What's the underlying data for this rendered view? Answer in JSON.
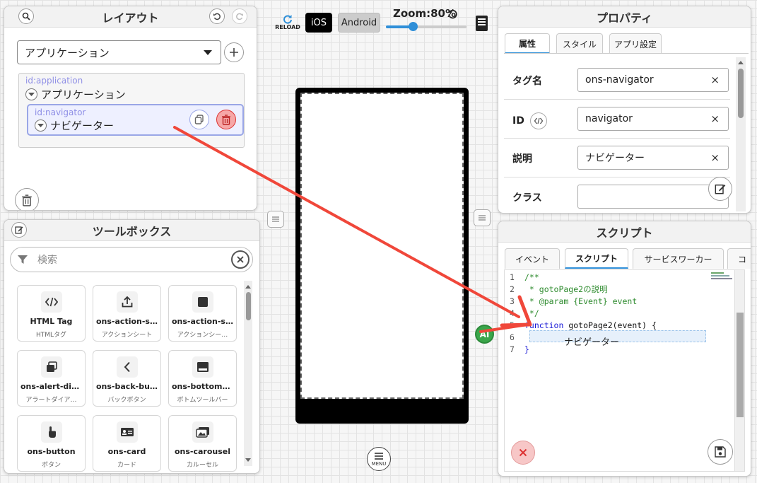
{
  "layout_panel": {
    "title": "レイアウト",
    "select_value": "アプリケーション",
    "tree": {
      "root": {
        "id_label": "id:application",
        "label": "アプリケーション"
      },
      "child": {
        "id_label": "id:navigator",
        "label": "ナビゲーター"
      }
    }
  },
  "toolbox_panel": {
    "title": "ツールボックス",
    "search_placeholder": "検索",
    "items": [
      {
        "title": "HTML Tag",
        "subtitle": "HTMLタグ",
        "icon": "code-icon"
      },
      {
        "title": "ons-action-sh…",
        "subtitle": "アクションシート",
        "icon": "share-icon"
      },
      {
        "title": "ons-action-sh…",
        "subtitle": "アクションシー…",
        "icon": "square-icon"
      },
      {
        "title": "ons-alert-dialog",
        "subtitle": "アラートダイア…",
        "icon": "dialog-icon"
      },
      {
        "title": "ons-back-butt…",
        "subtitle": "バックボタン",
        "icon": "chevron-left-icon"
      },
      {
        "title": "ons-bottom-t…",
        "subtitle": "ボトムツールバー",
        "icon": "toolbar-icon"
      },
      {
        "title": "ons-button",
        "subtitle": "ボタン",
        "icon": "hand-pointer-icon"
      },
      {
        "title": "ons-card",
        "subtitle": "カード",
        "icon": "id-card-icon"
      },
      {
        "title": "ons-carousel",
        "subtitle": "カルーセル",
        "icon": "images-icon"
      }
    ]
  },
  "toolbar": {
    "reload_label": "RELOAD",
    "ios_label": "iOS",
    "android_label": "Android",
    "zoom_label": "Zoom:80%",
    "zoom_value": 0.8
  },
  "property_panel": {
    "title": "プロパティ",
    "tabs": [
      "属性",
      "スタイル",
      "アプリ設定"
    ],
    "rows": [
      {
        "label": "タグ名",
        "value": "ons-navigator"
      },
      {
        "label": "ID",
        "value": "navigator"
      },
      {
        "label": "説明",
        "value": "ナビゲーター"
      },
      {
        "label": "クラス",
        "value": ""
      }
    ]
  },
  "script_panel": {
    "title": "スクリプト",
    "tabs": [
      "イベント",
      "スクリプト",
      "サービスワーカー",
      "コ"
    ],
    "ai_label": "AI",
    "drag_label": "ナビゲーター",
    "code": [
      {
        "n": "1",
        "text": "/**"
      },
      {
        "n": "2",
        "text": " * gotoPage2の説明"
      },
      {
        "n": "3",
        "text": " * @param {Event} event"
      },
      {
        "n": "4",
        "text": " */"
      },
      {
        "n": "5",
        "text": "function gotoPage2(event) {"
      },
      {
        "n": "6",
        "text": ""
      },
      {
        "n": "7",
        "text": "}"
      }
    ]
  },
  "menu_label": "MENU",
  "colors": {
    "accent": "#2f8fd8",
    "arrow": "#f0473a",
    "ai_green": "#3aa64a",
    "delete_red": "#e35d5d"
  }
}
